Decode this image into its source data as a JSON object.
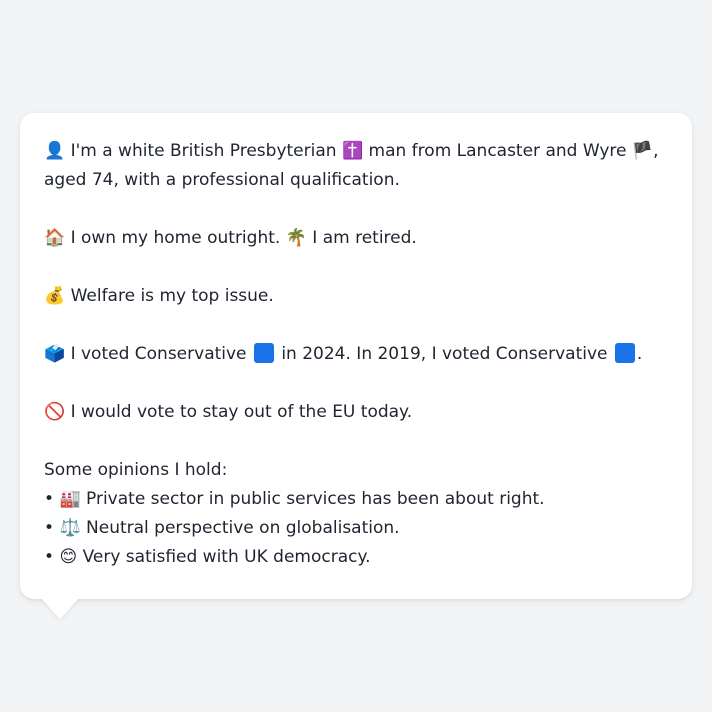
{
  "card": {
    "identity": {
      "icon": "👤",
      "text_a": "I'm a white British Presbyterian",
      "religion_icon": "✝️",
      "text_b": "man from Lancaster and Wyre",
      "flag_icon": "🏴",
      "text_c": ", aged 74, with a professional qualification."
    },
    "home": {
      "home_icon": "🏠",
      "text_a": "I own my home outright.",
      "palm_icon": "🌴",
      "text_b": "I am retired."
    },
    "issue": {
      "icon": "💰",
      "text": "Welfare is my top issue."
    },
    "vote": {
      "icon": "🗳️",
      "text_a": "I voted Conservative",
      "text_b": "in 2024. In 2019, I voted Conservative",
      "text_c": ".",
      "party_color": "#1a73e8"
    },
    "eu": {
      "icon": "🚫",
      "text": "I would vote to stay out of the EU today."
    },
    "opinions": {
      "heading": "Some opinions I hold:",
      "bullet": "•",
      "items": [
        {
          "icon": "🏭",
          "text": "Private sector in public services has been about right."
        },
        {
          "icon": "⚖️",
          "text": "Neutral perspective on globalisation."
        },
        {
          "icon": "😊",
          "text": "Very satisfied with UK democracy."
        }
      ]
    }
  }
}
